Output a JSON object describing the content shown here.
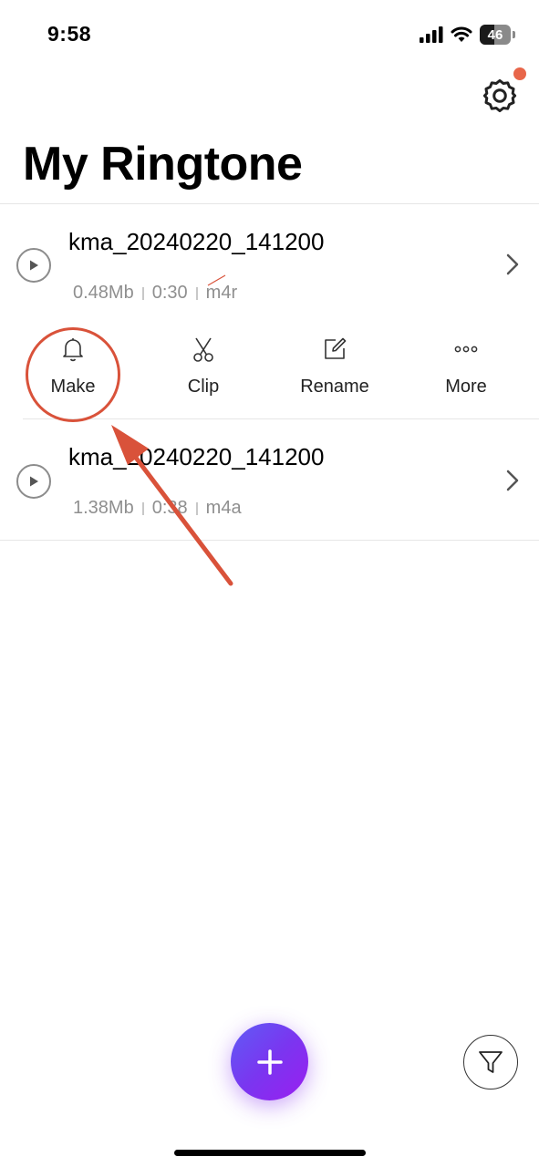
{
  "status_bar": {
    "time": "9:58",
    "battery": "46"
  },
  "header": {
    "title": "My Ringtone"
  },
  "ringtones": [
    {
      "title": "kma_20240220_141200",
      "size": "0.48Mb",
      "duration": "0:30",
      "format": "m4r"
    },
    {
      "title": "kma_20240220_141200",
      "size": "1.38Mb",
      "duration": "0:38",
      "format": "m4a"
    }
  ],
  "actions": {
    "make": "Make",
    "clip": "Clip",
    "rename": "Rename",
    "more": "More"
  },
  "icons": {
    "settings": "gear-icon",
    "play": "play-icon",
    "chevron": "chevron-right-icon",
    "make": "bell-icon",
    "clip": "scissors-icon",
    "rename": "edit-icon",
    "more": "more-dots-icon",
    "add": "plus-icon",
    "filter": "filter-icon"
  },
  "colors": {
    "accent_gradient_start": "#5f5cf5",
    "accent_gradient_end": "#9a1ef0",
    "notification_dot": "#e8664a",
    "annotation": "#d9523a"
  }
}
